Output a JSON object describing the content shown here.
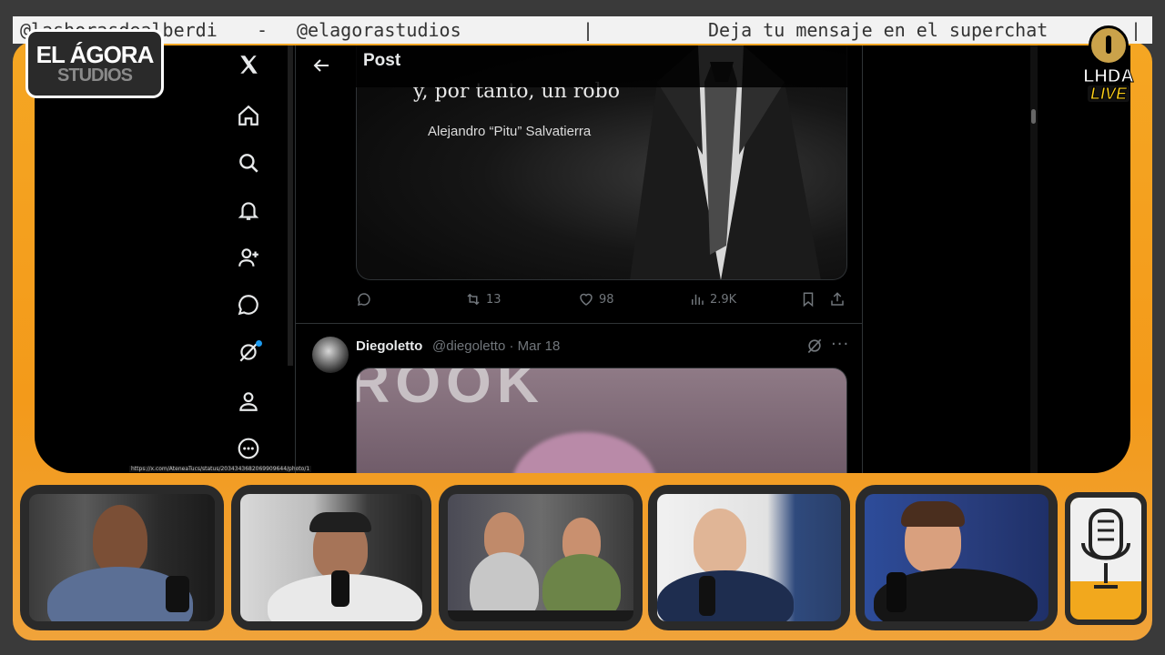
{
  "ticker": {
    "left_text": "@lashorasdealberdi",
    "dash": "-",
    "handle": "@elagorastudios",
    "separator": "|",
    "message": "Deja tu mensaje en el superchat",
    "separator2": "|"
  },
  "logo": {
    "line1": "EL ÁGORA",
    "line2": "STUDIOS"
  },
  "lhda": {
    "line1": "LHDA",
    "line2": "LIVE"
  },
  "nav": {
    "items": [
      {
        "name": "x-logo-icon"
      },
      {
        "name": "home-icon"
      },
      {
        "name": "search-icon"
      },
      {
        "name": "notifications-bell-icon"
      },
      {
        "name": "follow-add-user-icon"
      },
      {
        "name": "messages-icon"
      },
      {
        "name": "grok-icon"
      },
      {
        "name": "profile-icon"
      },
      {
        "name": "more-icon"
      }
    ],
    "link_preview": "https://x.com/AteneaTucs/status/2034343682069909644/photo/1"
  },
  "post": {
    "header_title": "Post",
    "media_quote": "y, por tanto, un robo",
    "media_author": "Alejandro “Pitu” Salvatierra",
    "actions": {
      "replies": "",
      "reposts": "13",
      "likes": "98",
      "views": "2.9K"
    }
  },
  "tweet2": {
    "name": "Diegoletto",
    "handle": "@diegoletto · Mar 18",
    "more": "···"
  },
  "colors": {
    "frame": "#f5a623",
    "x_accent": "#1d9bf0",
    "x_muted": "#71767b"
  }
}
